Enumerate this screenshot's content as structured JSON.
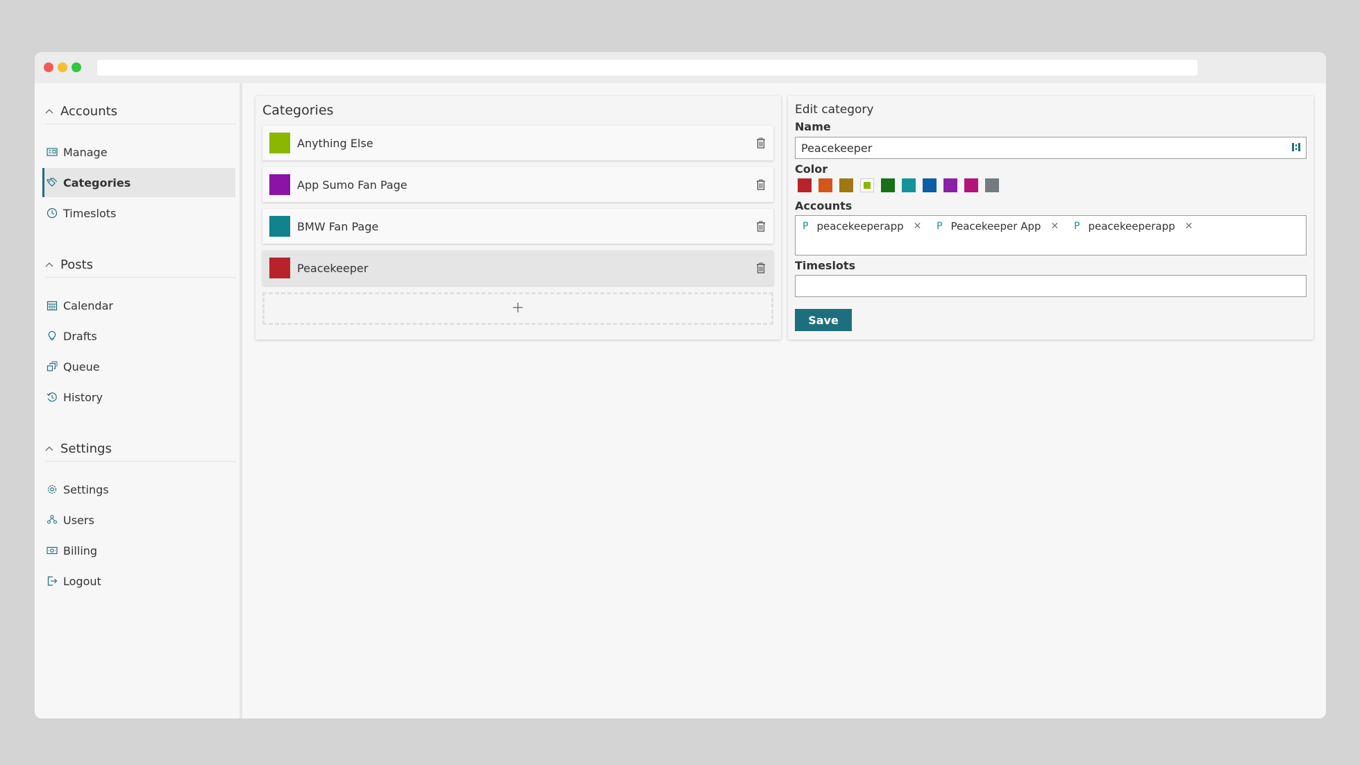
{
  "sidebar": {
    "sections": [
      {
        "title": "Accounts",
        "items": [
          "Manage",
          "Categories",
          "Timeslots"
        ]
      },
      {
        "title": "Posts",
        "items": [
          "Calendar",
          "Drafts",
          "Queue",
          "History"
        ]
      },
      {
        "title": "Settings",
        "items": [
          "Settings",
          "Users",
          "Billing",
          "Logout"
        ]
      }
    ],
    "active_item": "Categories"
  },
  "categories": {
    "title": "Categories",
    "items": [
      {
        "name": "Anything Else",
        "color": "#8ab800"
      },
      {
        "name": "App Sumo Fan Page",
        "color": "#8b14a6"
      },
      {
        "name": "BMW Fan Page",
        "color": "#12828f"
      },
      {
        "name": "Peacekeeper",
        "color": "#b8232b"
      }
    ],
    "selected_index": 3
  },
  "edit": {
    "title": "Edit category",
    "name_label": "Name",
    "name_value": "Peacekeeper",
    "color_label": "Color",
    "colors": [
      "#b8232b",
      "#d4561a",
      "#a07812",
      "#8ab800",
      "#157316",
      "#12949a",
      "#0d5ea5",
      "#8b1fa6",
      "#b3137a",
      "#737a80"
    ],
    "selected_color_index": 3,
    "accounts_label": "Accounts",
    "accounts": [
      {
        "prefix": "P",
        "name": "peacekeeperapp"
      },
      {
        "prefix": "P",
        "name": "Peacekeeper App"
      },
      {
        "prefix": "P",
        "name": "peacekeeperapp"
      }
    ],
    "timeslots_label": "Timeslots",
    "save_label": "Save"
  },
  "accent_color": "#1e6f7d"
}
